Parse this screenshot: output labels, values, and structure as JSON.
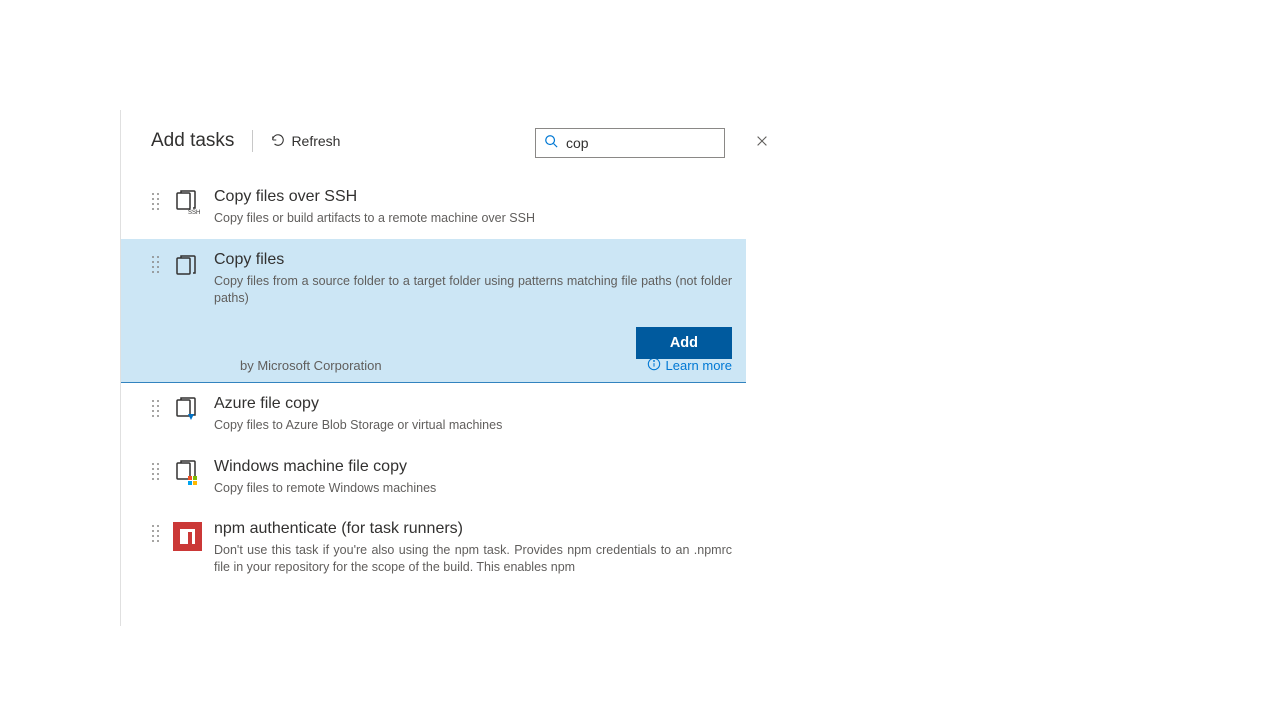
{
  "header": {
    "title": "Add tasks",
    "refresh_label": "Refresh"
  },
  "search": {
    "value": "cop"
  },
  "tasks": [
    {
      "title": "Copy files over SSH",
      "desc": "Copy files or build artifacts to a remote machine over SSH",
      "icon": "copy-ssh"
    },
    {
      "title": "Copy files",
      "desc": "Copy files from a source folder to a target folder using patterns matching file paths (not folder paths)",
      "icon": "copy",
      "selected": true,
      "publisher": "by Microsoft Corporation",
      "add_label": "Add",
      "learn_more_label": "Learn more"
    },
    {
      "title": "Azure file copy",
      "desc": "Copy files to Azure Blob Storage or virtual machines",
      "icon": "azure-copy"
    },
    {
      "title": "Windows machine file copy",
      "desc": "Copy files to remote Windows machines",
      "icon": "windows-copy"
    },
    {
      "title": "npm authenticate (for task runners)",
      "desc": "Don't use this task if you're also using the npm task. Provides npm credentials to an .npmrc file in your repository for the scope of the build. This enables npm",
      "icon": "npm"
    }
  ]
}
